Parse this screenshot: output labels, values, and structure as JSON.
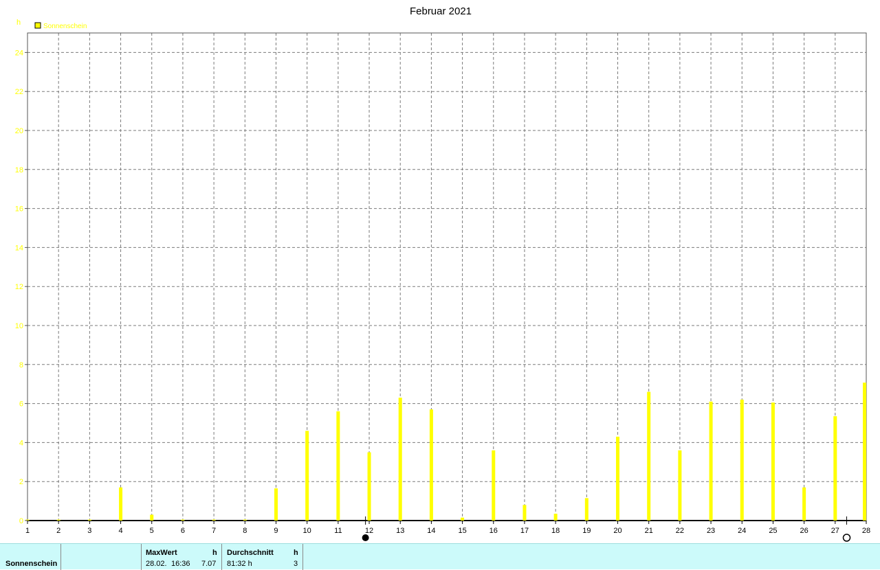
{
  "chart_data": {
    "type": "bar",
    "title": "Februar 2021",
    "ylabel": "h",
    "ylim": [
      0,
      25
    ],
    "yticks": [
      0,
      2,
      4,
      6,
      8,
      10,
      12,
      14,
      16,
      18,
      20,
      22,
      24
    ],
    "grid": true,
    "legend_placement": "top-left",
    "series": [
      {
        "name": "Sonnenschein",
        "color": "#ffff00",
        "categories": [
          1,
          2,
          3,
          4,
          5,
          6,
          7,
          8,
          9,
          10,
          11,
          12,
          13,
          14,
          15,
          16,
          17,
          18,
          19,
          20,
          21,
          22,
          23,
          24,
          25,
          26,
          27,
          28
        ],
        "values": [
          0.05,
          0.05,
          0.05,
          1.7,
          0.3,
          0.05,
          0.05,
          0.05,
          1.65,
          4.6,
          5.6,
          3.5,
          6.3,
          5.7,
          0.15,
          3.6,
          0.8,
          0.35,
          1.15,
          4.3,
          6.6,
          3.6,
          6.1,
          6.2,
          6.05,
          1.7,
          5.35,
          7.07
        ]
      }
    ],
    "moon_phases": [
      {
        "day": 11.88,
        "symbol": "new-moon"
      },
      {
        "day": 27.37,
        "symbol": "full-moon"
      }
    ]
  },
  "footer": {
    "series_label": "Sonnenschein",
    "max_header": "MaxWert",
    "max_unit": "h",
    "max_date": "28.02.",
    "max_time": "16:36",
    "max_value": "7.07",
    "avg_header": "Durchschnitt",
    "avg_unit": "h",
    "avg_value": "81:32 h",
    "avg_count": "3"
  }
}
